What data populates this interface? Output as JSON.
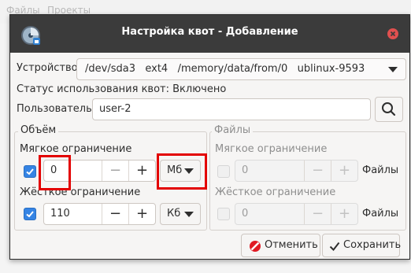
{
  "background": {
    "menu_items": [
      "Файлы",
      "Проекты"
    ]
  },
  "window": {
    "title": "Настройка квот - Добавление",
    "icon": "disk-quota-icon",
    "close_icon": "close-icon"
  },
  "device": {
    "label": "Устройство:",
    "value": "/dev/sda3   ext4   /memory/data/from/0   ublinux-9593"
  },
  "status": {
    "text": "Статус использования квот: Включено"
  },
  "user": {
    "label": "Пользователь:",
    "value": "user-2",
    "search_icon": "search-icon"
  },
  "volume": {
    "title": "Объём",
    "soft": {
      "label": "Мягкое ограничение",
      "checked": true,
      "value": "0",
      "unit": "Мб"
    },
    "hard": {
      "label": "Жёсткое ограничение",
      "checked": true,
      "value": "110",
      "unit": "Кб"
    }
  },
  "files": {
    "title": "Файлы",
    "soft": {
      "label": "Мягкое ограничение",
      "checked": false,
      "value": "0",
      "unit": "Файлы"
    },
    "hard": {
      "label": "Жёсткое ограничение",
      "checked": false,
      "value": "0",
      "unit": "Файлы"
    }
  },
  "spin": {
    "minus": "−",
    "plus": "+"
  },
  "buttons": {
    "cancel": "Отменить",
    "cancel_icon": "cancel-icon",
    "save": "Сохранить",
    "save_icon": "checkmark-icon"
  },
  "colors": {
    "accent": "#3584e4",
    "titlebar": "#3b3b3b",
    "highlight": "#e30000",
    "close": "#e0504f"
  }
}
